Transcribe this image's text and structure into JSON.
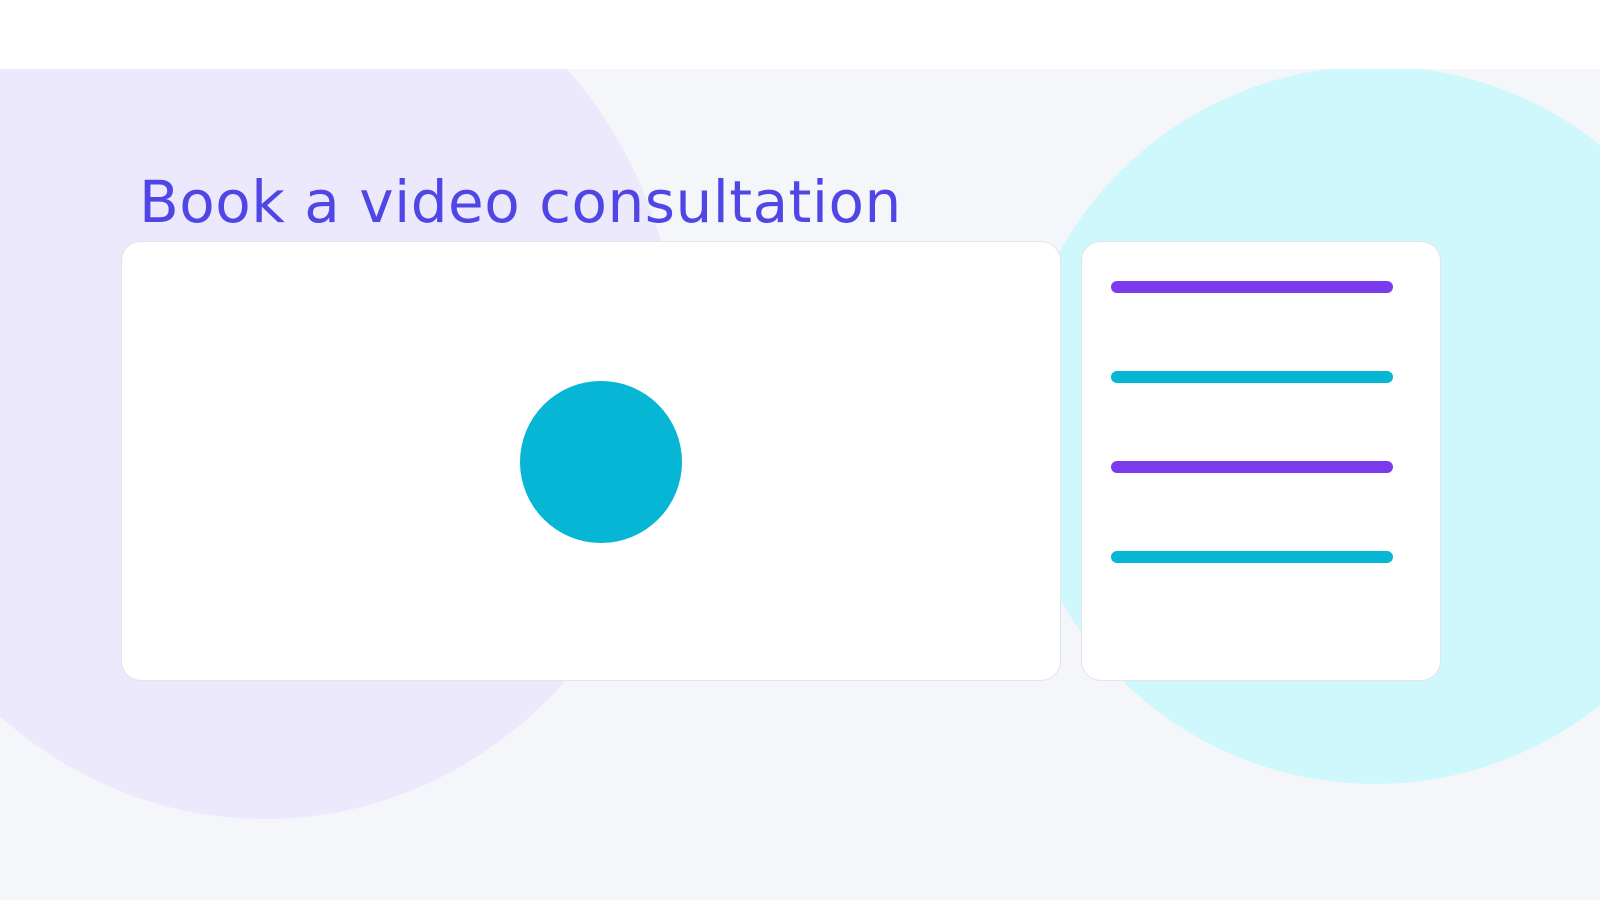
{
  "page": {
    "title": "Book a video consultation"
  },
  "colors": {
    "title": "#4f46e5",
    "blob_left": "#ece9fd",
    "blob_right": "#cff8fc",
    "accent_cyan": "#06b6d4",
    "accent_purple": "#7c3aed"
  },
  "video_panel": {
    "icon": "play-circle-icon"
  },
  "side_panel": {
    "lines": [
      {
        "color": "#7c3aed"
      },
      {
        "color": "#06b6d4"
      },
      {
        "color": "#7c3aed"
      },
      {
        "color": "#06b6d4"
      }
    ]
  }
}
